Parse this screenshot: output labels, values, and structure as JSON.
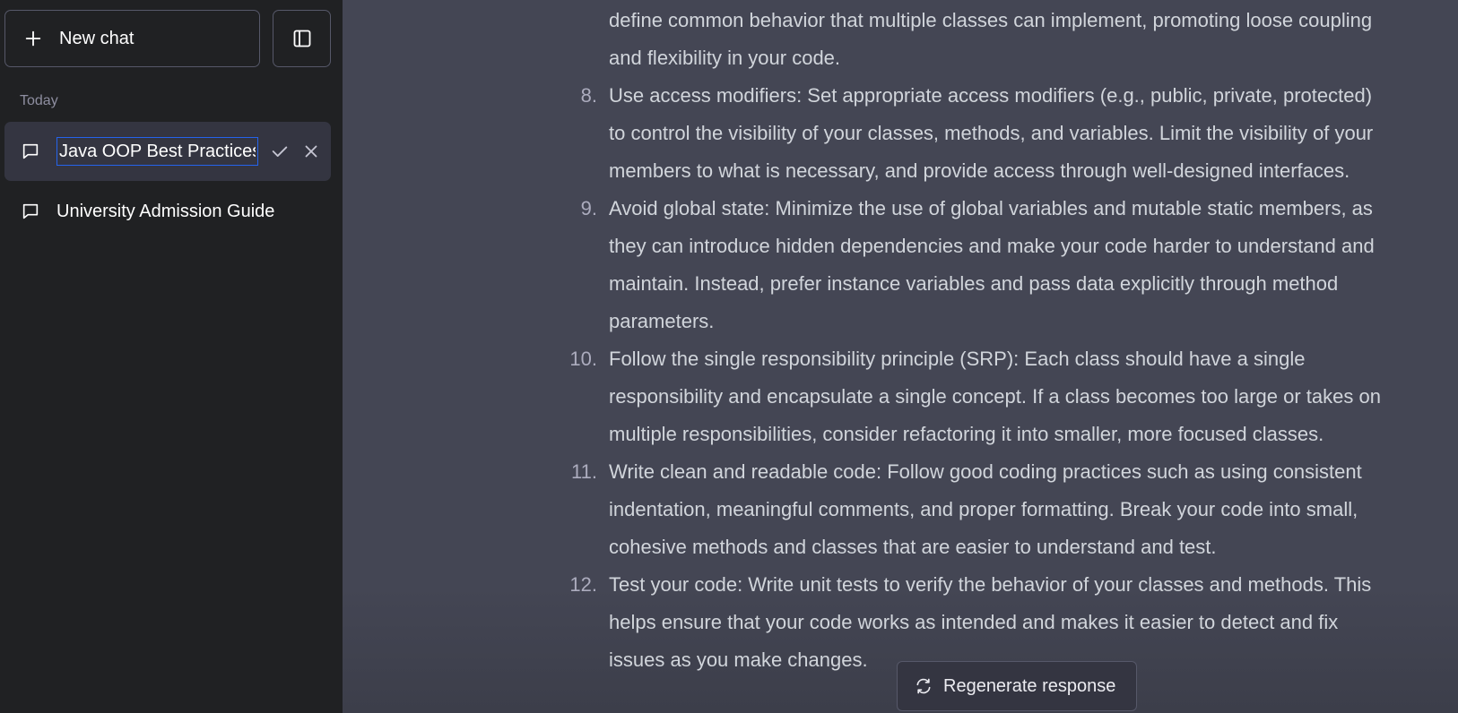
{
  "sidebar": {
    "new_chat_label": "New chat",
    "section_label": "Today",
    "active_chat_title": "Java OOP Best Practices",
    "chats": [
      "University Admission Guide"
    ]
  },
  "response": {
    "first_item_tail": [
      "define common behavior that multiple classes can implement, promoting loose coupling",
      "and flexibility in your code."
    ],
    "items": [
      {
        "num": "8.",
        "lines": [
          "Use access modifiers: Set appropriate access modifiers (e.g., public, private, protected)",
          "to control the visibility of your classes, methods, and variables. Limit the visibility of your",
          "members to what is necessary, and provide access through well-designed interfaces."
        ]
      },
      {
        "num": "9.",
        "lines": [
          "Avoid global state: Minimize the use of global variables and mutable static members, as",
          "they can introduce hidden dependencies and make your code harder to understand and",
          "maintain. Instead, prefer instance variables and pass data explicitly through method",
          "parameters."
        ]
      },
      {
        "num": "10.",
        "lines": [
          "Follow the single responsibility principle (SRP): Each class should have a single",
          "responsibility and encapsulate a single concept. If a class becomes too large or takes on",
          "multiple responsibilities, consider refactoring it into smaller, more focused classes."
        ]
      },
      {
        "num": "11.",
        "lines": [
          "Write clean and readable code: Follow good coding practices such as using consistent",
          "indentation, meaningful comments, and proper formatting. Break your code into small,",
          "cohesive methods and classes that are easier to understand and test."
        ]
      },
      {
        "num": "12.",
        "lines": [
          "Test your code: Write unit tests to verify the behavior of your classes and methods. This",
          "helps ensure that your code works as intended and makes it easier to detect and fix",
          "issues as you make changes."
        ]
      }
    ]
  },
  "regenerate_label": "Regenerate response",
  "colors": {
    "sidebar_bg": "#202123",
    "content_bg": "#444654",
    "input_border": "#2563eb"
  }
}
